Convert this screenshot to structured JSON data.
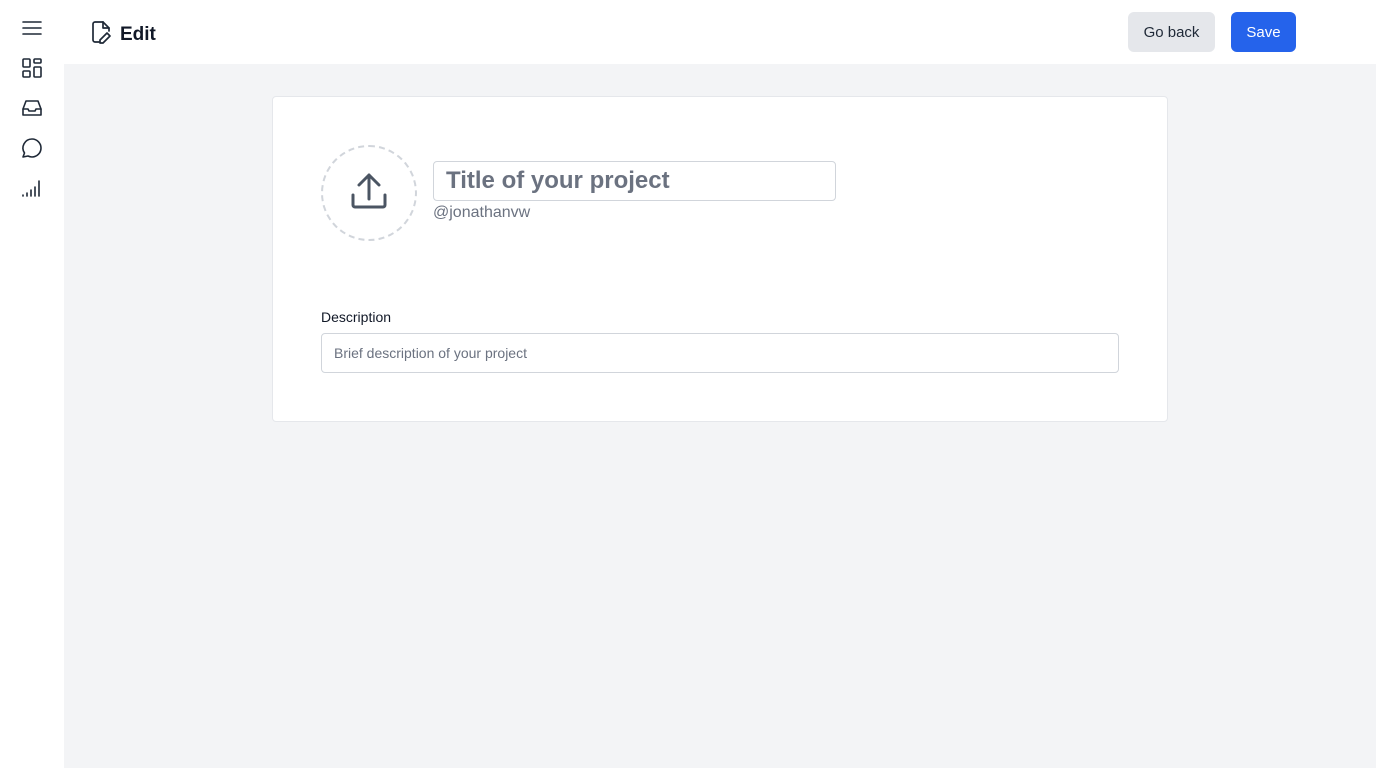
{
  "sidebar": {
    "items": [
      {
        "icon": "menu-icon"
      },
      {
        "icon": "dashboard-icon"
      },
      {
        "icon": "inbox-icon"
      },
      {
        "icon": "chat-icon"
      },
      {
        "icon": "signal-icon"
      }
    ]
  },
  "header": {
    "title": "Edit",
    "icon": "document-edit-icon",
    "back_label": "Go back",
    "save_label": "Save"
  },
  "form": {
    "title_placeholder": "Title of your project",
    "username": "@jonathanvw",
    "description_label": "Description",
    "description_placeholder": "Brief description of your project",
    "upload_icon": "upload-icon"
  },
  "colors": {
    "accent": "#2563eb",
    "background": "#f3f4f6",
    "secondary_button": "#e5e7eb"
  }
}
